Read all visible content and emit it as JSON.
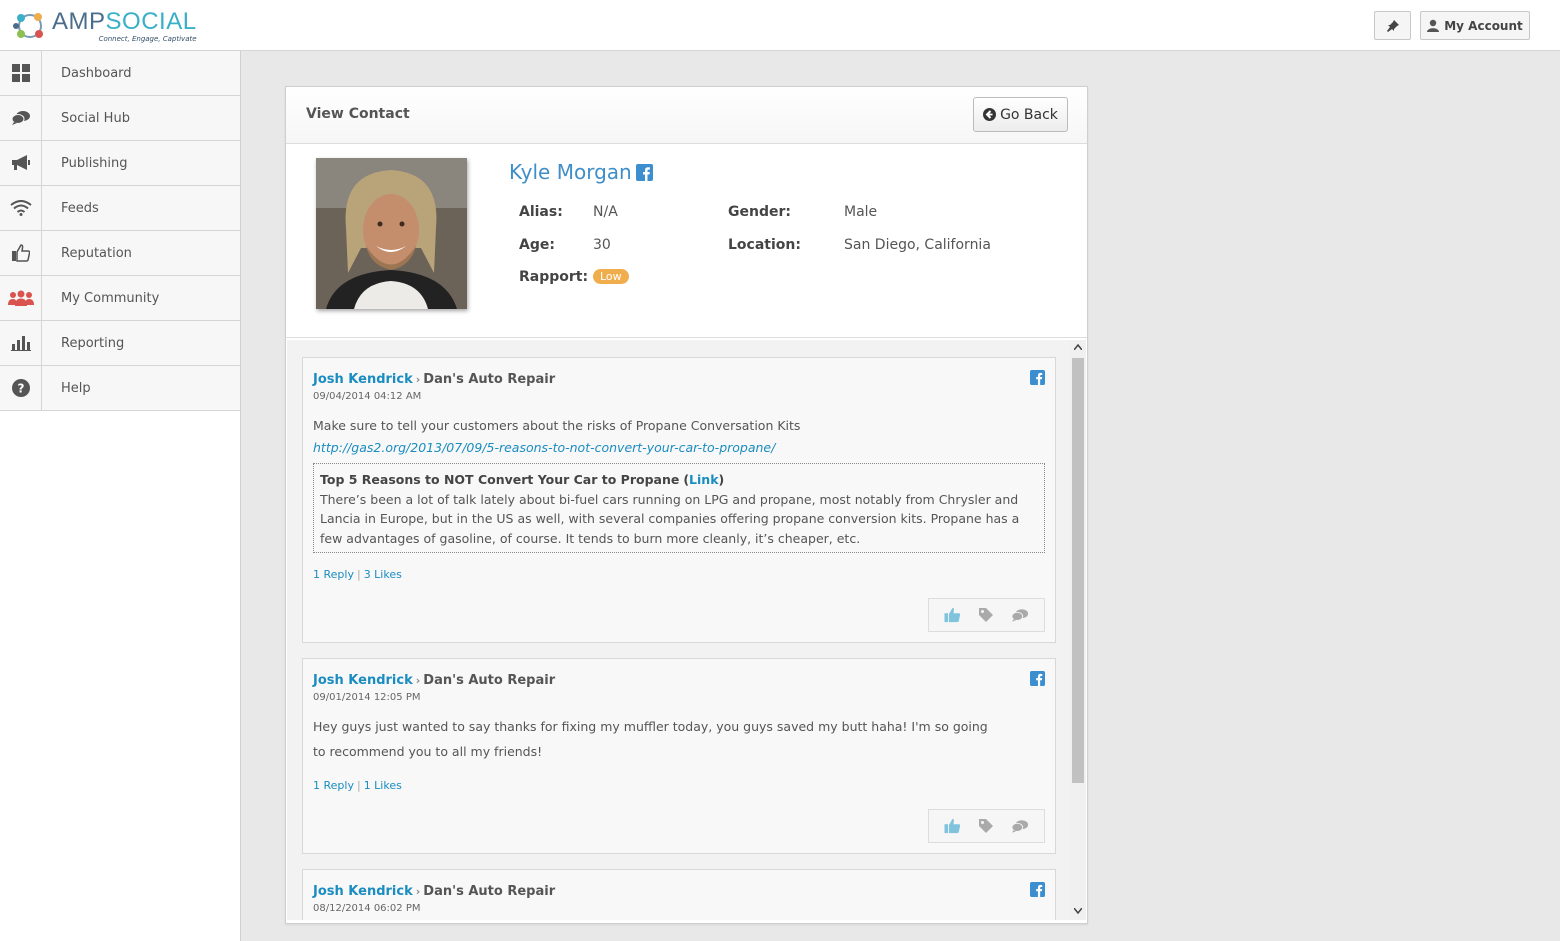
{
  "app": {
    "logo_amp": "AMP",
    "logo_social": "SOCIAL",
    "tagline": "Connect, Engage, Captivate",
    "account_label": "My Account"
  },
  "sidebar": {
    "items": [
      {
        "label": "Dashboard",
        "icon": "dashboard-icon"
      },
      {
        "label": "Social Hub",
        "icon": "chat-icon"
      },
      {
        "label": "Publishing",
        "icon": "megaphone-icon"
      },
      {
        "label": "Feeds",
        "icon": "wifi-icon"
      },
      {
        "label": "Reputation",
        "icon": "thumbs-up-icon"
      },
      {
        "label": "My Community",
        "icon": "users-icon"
      },
      {
        "label": "Reporting",
        "icon": "bar-chart-icon"
      },
      {
        "label": "Help",
        "icon": "help-icon"
      }
    ]
  },
  "panel": {
    "title": "View Contact",
    "back_label": "Go Back"
  },
  "contact": {
    "name": "Kyle Morgan",
    "alias_label": "Alias:",
    "alias": "N/A",
    "age_label": "Age:",
    "age": "30",
    "rapport_label": "Rapport:",
    "rapport": "Low",
    "gender_label": "Gender:",
    "gender": "Male",
    "location_label": "Location:",
    "location": "San Diego, California"
  },
  "posts": [
    {
      "author": "Josh Kendrick",
      "page": "Dan's Auto Repair",
      "date": "09/04/2014 04:12 AM",
      "text": "Make sure to tell your customers about the risks of Propane Conversation Kits",
      "link": "http://gas2.org/2013/07/09/5-reasons-to-not-convert-your-car-to-propane/",
      "preview_title": "Top 5 Reasons to NOT Convert Your Car to Propane",
      "preview_link": "Link",
      "preview_body": "There’s been a lot of talk lately about bi-fuel cars running on LPG and propane, most notably from Chrysler and Lancia in Europe, but in the US as well, with several companies offering propane conversion kits. Propane has a few advantages of gasoline, of course. It tends to burn more cleanly, it’s cheaper, etc.",
      "replies": "1 Reply",
      "likes": "3 Likes"
    },
    {
      "author": "Josh Kendrick",
      "page": "Dan's Auto Repair",
      "date": "09/01/2014 12:05 PM",
      "text": "Hey guys just wanted to say thanks for fixing my muffler today, you guys saved my butt haha! I'm so going to recommend you to all my friends!",
      "replies": "1 Reply",
      "likes": "1 Likes"
    },
    {
      "author": "Josh Kendrick",
      "page": "Dan's Auto Repair",
      "date": "08/12/2014 06:02 PM"
    }
  ]
}
